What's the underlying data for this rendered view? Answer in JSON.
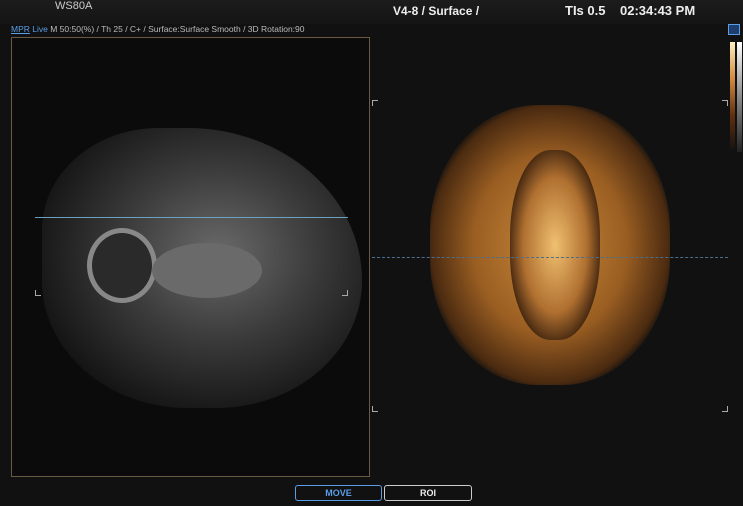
{
  "header": {
    "model": "WS80A",
    "probe_mode": "V4-8 / Surface /",
    "tis": "TIs 0.5",
    "time": "02:34:43 PM"
  },
  "info": {
    "mpr": "MPR",
    "live": "Live",
    "params": "M 50:50(%) / Th 25 / C+ / Surface:Surface Smooth / 3D Rotation:90"
  },
  "buttons": {
    "move": "MOVE",
    "roi": "ROI"
  },
  "colors": {
    "accent": "#5a9ee8",
    "frame": "#6a5a44"
  }
}
